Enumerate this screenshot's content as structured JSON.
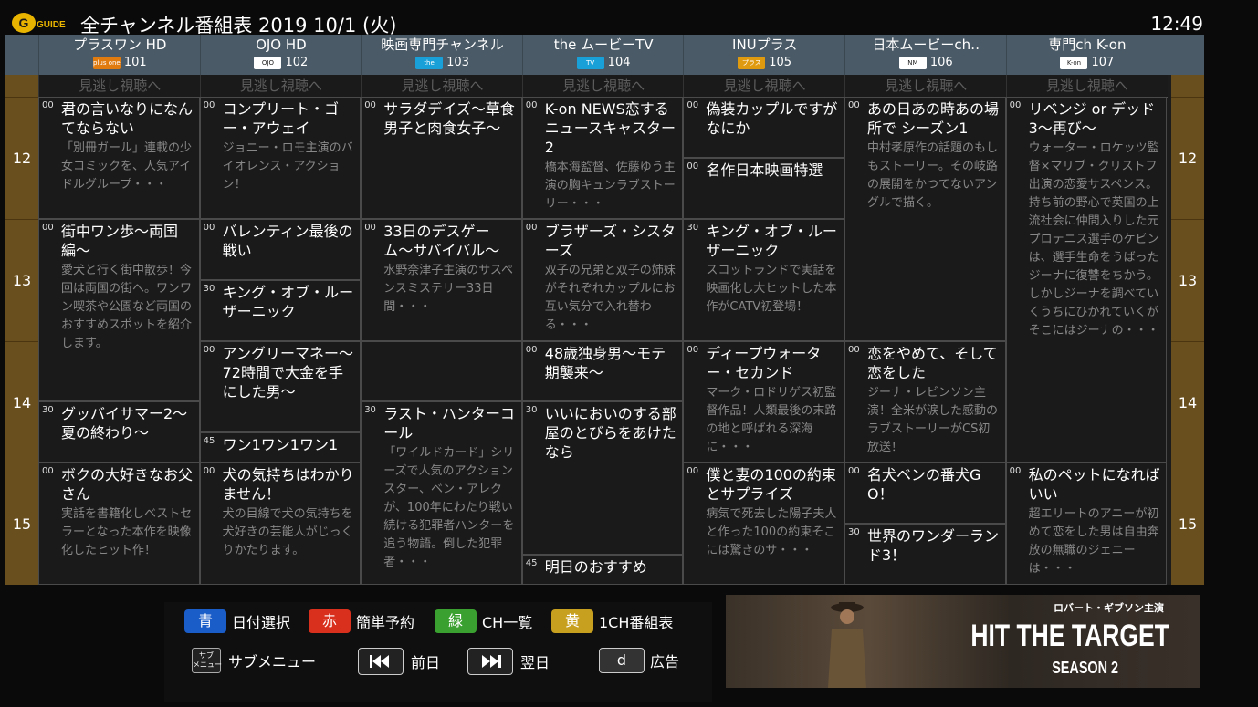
{
  "header": {
    "logo_text": "G GUIDE",
    "title": "全チャンネル番組表 2019 10/1 (火)",
    "clock": "12:49"
  },
  "missed_label": "見逃し視聴へ",
  "hours": [
    "12",
    "13",
    "14",
    "15"
  ],
  "channels": [
    {
      "name": "プラスワン HD",
      "badge": "plus one",
      "badge_color": "#e07b10",
      "number": "101"
    },
    {
      "name": "OJO HD",
      "badge": "OJO",
      "badge_color": "#ffffff",
      "number": "102"
    },
    {
      "name": "映画専門チャンネル",
      "badge": "the MOVIE",
      "badge_color": "#1aa0d8",
      "number": "103"
    },
    {
      "name": "the ムービーTV",
      "badge": "TV",
      "badge_color": "#1aa0d8",
      "number": "104"
    },
    {
      "name": "INUプラス",
      "badge": "プラス",
      "badge_color": "#e09a10",
      "number": "105"
    },
    {
      "name": "日本ムービーch‥",
      "badge": "NM",
      "badge_color": "#ffffff",
      "number": "106"
    },
    {
      "name": "専門ch K-on",
      "badge": "K-on",
      "badge_color": "#ffffff",
      "number": "107"
    }
  ],
  "programs": [
    [
      {
        "min": "00",
        "title": "君の言いなりになんてならない",
        "desc": "「別冊ガール」連載の少女コミックを、人気アイドルグループ・・・",
        "slots": 1
      },
      {
        "min": "00",
        "title": "街中ワン歩〜両国編〜",
        "desc": "愛犬と行く街中散歩！今回は両国の街へ。ワンワン喫茶や公園など両国のおすすめスポットを紹介します。",
        "slots": 1.5
      },
      {
        "min": "30",
        "title": "グッバイサマー2〜夏の終わり〜",
        "desc": "",
        "slots": 0.5
      },
      {
        "min": "00",
        "title": "ボクの大好きなお父さん",
        "desc": "実話を書籍化しベストセラーとなった本作を映像化したヒット作！",
        "slots": 1
      }
    ],
    [
      {
        "min": "00",
        "title": "コンプリート・ゴー・アウェイ",
        "desc": "ジョニー・ロモ主演のバイオレンス・アクション！",
        "slots": 1
      },
      {
        "min": "00",
        "title": "バレンティン最後の戦い",
        "desc": "",
        "slots": 0.5
      },
      {
        "min": "30",
        "title": "キング・オブ・ルーザーニック",
        "desc": "",
        "slots": 0.5
      },
      {
        "min": "00",
        "title": "アングリーマネー〜72時間で大金を手にした男〜",
        "desc": "",
        "slots": 0.75
      },
      {
        "min": "45",
        "title": "ワン1ワン1ワン1",
        "desc": "",
        "slots": 0.25
      },
      {
        "min": "00",
        "title": "犬の気持ちはわかりません！",
        "desc": "犬の目線で犬の気持ちを犬好きの芸能人がじっくりかたります。",
        "slots": 1
      }
    ],
    [
      {
        "min": "00",
        "title": "サラダデイズ〜草食男子と肉食女子〜",
        "desc": "",
        "slots": 1
      },
      {
        "min": "00",
        "title": "33日のデスゲーム〜サバイバル〜",
        "desc": "水野奈津子主演のサスペンスミステリー33日間・・・",
        "slots": 1
      },
      {
        "min": "",
        "title": "",
        "desc": "",
        "slots": 0.5
      },
      {
        "min": "30",
        "title": "ラスト・ハンターコール",
        "desc": "「ワイルドカード」シリーズで人気のアクションスター、ベン・アレクが、100年にわたり戦い続ける犯罪者ハンターを追う物語。倒した犯罪者・・・",
        "slots": 1.5
      }
    ],
    [
      {
        "min": "00",
        "title": "K-on NEWS恋するニュースキャスター2",
        "desc": "橋本海監督、佐藤ゆう主演の胸キュンラブストーリー・・・",
        "slots": 1
      },
      {
        "min": "00",
        "title": "ブラザーズ・シスターズ",
        "desc": "双子の兄弟と双子の姉妹がそれぞれカップルにお互い気分で入れ替わる・・・",
        "slots": 1
      },
      {
        "min": "00",
        "title": "48歳独身男〜モテ期襲来〜",
        "desc": "",
        "slots": 0.5
      },
      {
        "min": "30",
        "title": "いいにおいのする部屋のとびらをあけたなら",
        "desc": "",
        "slots": 1.25
      },
      {
        "min": "45",
        "title": "明日のおすすめ",
        "desc": "",
        "slots": 0.25
      }
    ],
    [
      {
        "min": "00",
        "title": "偽装カップルですがなにか",
        "desc": "",
        "slots": 0.5
      },
      {
        "min": "00",
        "title": "名作日本映画特選",
        "desc": "",
        "slots": 0.5
      },
      {
        "min": "30",
        "title": "キング・オブ・ルーザーニック",
        "desc": "スコットランドで実話を映画化し大ヒットした本作がCATV初登場！",
        "slots": 1
      },
      {
        "min": "00",
        "title": "ディープウォーター・セカンド",
        "desc": "マーク・ロドリゲス初監督作品！人類最後の末路の地と呼ばれる深海に・・・",
        "slots": 1
      },
      {
        "min": "00",
        "title": "僕と妻の100の約束とサプライズ",
        "desc": "病気で死去した陽子夫人と作った100の約束そこには驚きのサ・・・",
        "slots": 1
      }
    ],
    [
      {
        "min": "00",
        "title": "あの日あの時あの場所で シーズン1",
        "desc": "中村孝原作の話題のもしもストーリー。その岐路の展開をかつてないアングルで描く。",
        "slots": 2
      },
      {
        "min": "00",
        "title": "恋をやめて、そして恋をした",
        "desc": "ジーナ・レビンソン主演！全米が涙した感動のラブストーリーがCS初放送！",
        "slots": 1
      },
      {
        "min": "00",
        "title": "名犬ベンの番犬GO！",
        "desc": "",
        "slots": 0.5
      },
      {
        "min": "30",
        "title": "世界のワンダーランド3！",
        "desc": "",
        "slots": 0.5
      }
    ],
    [
      {
        "min": "00",
        "title": "リベンジ or デッド3〜再び〜",
        "desc": "ウォーター・ロケッツ監督×マリブ・クリストフ出演の恋愛サスペンス。持ち前の野心で英国の上流社会に仲間入りした元プロテニス選手のケビンは、選手生命をうばったジーナに復讐をちかう。しかしジーナを調べていくうちにひかれていくがそこにはジーナの・・・",
        "slots": 3
      },
      {
        "min": "00",
        "title": "私のペットになればいい",
        "desc": "超エリートのアニーが初めて恋をした男は自由奔放の無職のジェニーは・・・",
        "slots": 1
      }
    ]
  ],
  "footer": {
    "blue": {
      "key": "青",
      "label": "日付選択",
      "color": "#1a5cc8"
    },
    "red": {
      "key": "赤",
      "label": "簡単予約",
      "color": "#d8301c"
    },
    "green": {
      "key": "緑",
      "label": "CH一覧",
      "color": "#3aa030"
    },
    "yellow": {
      "key": "黄",
      "label": "1CH番組表",
      "color": "#c8a020"
    },
    "sub": {
      "key": "サブメニュー",
      "label": "サブメニュー"
    },
    "prev": {
      "label": "前日"
    },
    "next": {
      "label": "翌日"
    },
    "d": {
      "key": "d",
      "label": "広告"
    }
  },
  "ad": {
    "tagline": "ロバート・ギブソン主演",
    "title": "HIT THE TARGET",
    "subtitle": "SEASON 2"
  }
}
